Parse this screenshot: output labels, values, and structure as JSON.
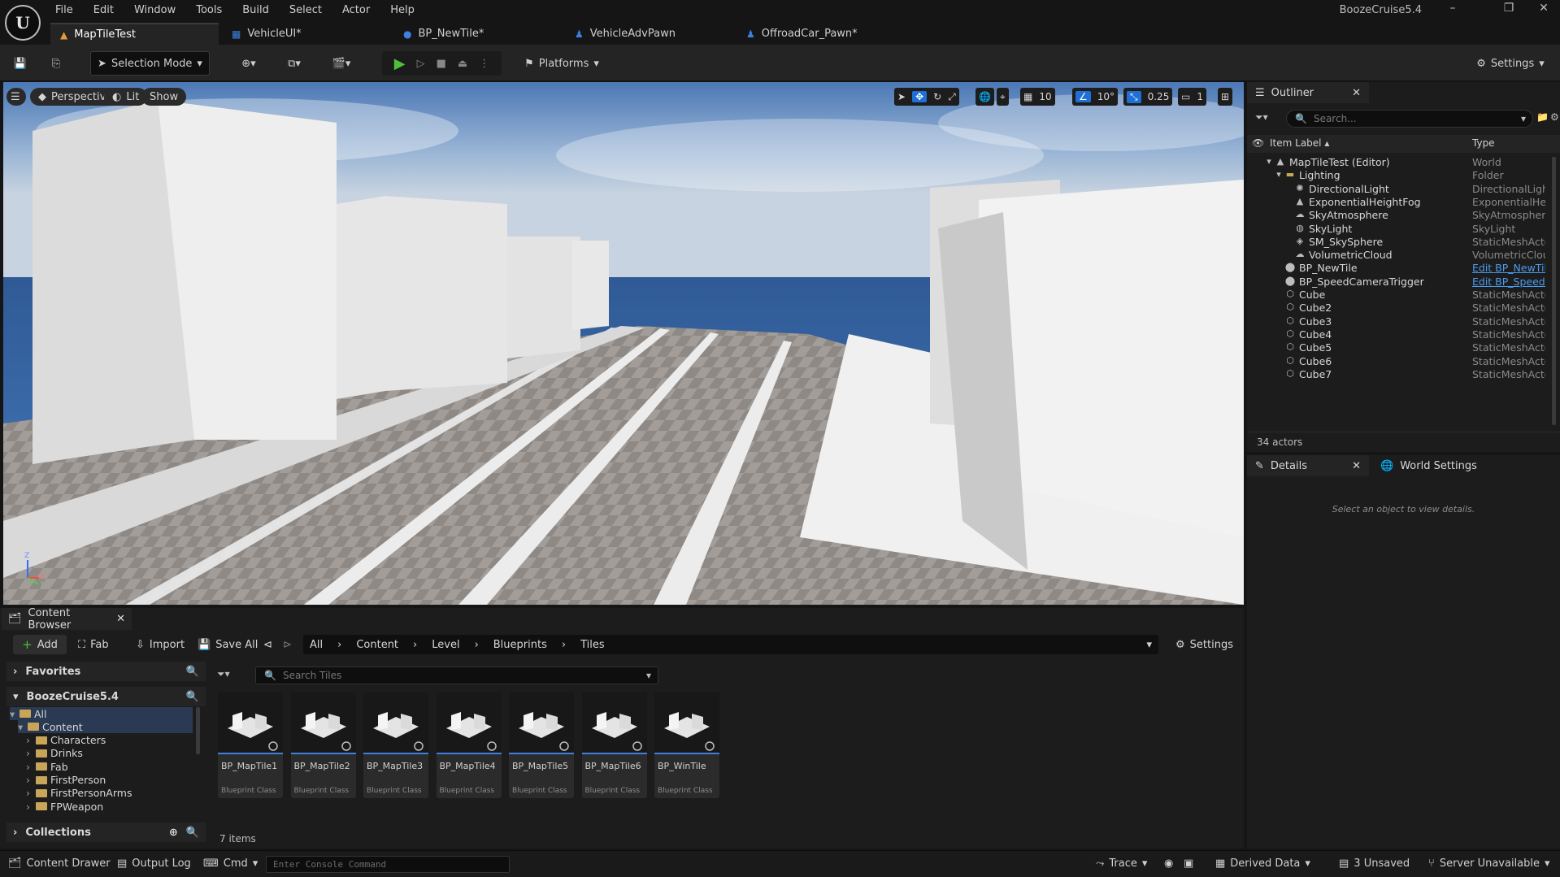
{
  "menu": [
    "File",
    "Edit",
    "Window",
    "Tools",
    "Build",
    "Select",
    "Actor",
    "Help"
  ],
  "project_name": "BoozeCruise5.4",
  "tabs": [
    {
      "label": "MapTileTest",
      "icon": "level-icon"
    },
    {
      "label": "VehicleUI*",
      "icon": "widget-icon"
    },
    {
      "label": "BP_NewTile*",
      "icon": "blueprint-icon"
    },
    {
      "label": "VehicleAdvPawn",
      "icon": "pawn-icon"
    },
    {
      "label": "OffroadCar_Pawn*",
      "icon": "pawn-icon"
    }
  ],
  "toolbar": {
    "selection_mode": "Selection Mode",
    "platforms": "Platforms",
    "settings": "Settings"
  },
  "viewport": {
    "perspective": "Perspective",
    "lit": "Lit",
    "show": "Show",
    "grid_snap": "10",
    "rotation_snap": "10°",
    "scale_snap": "0.25",
    "camera_speed": "1",
    "axis_z": "Z",
    "axis_x": "X",
    "axis_y": "Y"
  },
  "outliner": {
    "title": "Outliner",
    "search_placeholder": "Search...",
    "col_label": "Item Label",
    "col_type": "Type",
    "rows": [
      {
        "label": "MapTileTest (Editor)",
        "type": "World",
        "indent": 0,
        "icon": "world-icon"
      },
      {
        "label": "Lighting",
        "type": "Folder",
        "indent": 1,
        "icon": "folder-icon"
      },
      {
        "label": "DirectionalLight",
        "type": "DirectionalLight",
        "indent": 2,
        "icon": "sun-icon"
      },
      {
        "label": "ExponentialHeightFog",
        "type": "ExponentialHeightFog",
        "indent": 2,
        "icon": "fog-icon"
      },
      {
        "label": "SkyAtmosphere",
        "type": "SkyAtmosphere",
        "indent": 2,
        "icon": "atmosphere-icon"
      },
      {
        "label": "SkyLight",
        "type": "SkyLight",
        "indent": 2,
        "icon": "skylight-icon"
      },
      {
        "label": "SM_SkySphere",
        "type": "StaticMeshActor",
        "indent": 2,
        "icon": "mesh-icon"
      },
      {
        "label": "VolumetricCloud",
        "type": "VolumetricCloud",
        "indent": 2,
        "icon": "cloud-icon"
      },
      {
        "label": "BP_NewTile",
        "type": "Edit BP_NewTile",
        "indent": 1,
        "icon": "actor-icon",
        "link": true
      },
      {
        "label": "BP_SpeedCameraTrigger",
        "type": "Edit BP_SpeedCameraTrigger",
        "indent": 1,
        "icon": "actor-icon",
        "link": true
      },
      {
        "label": "Cube",
        "type": "StaticMeshActor",
        "indent": 1,
        "icon": "cube-icon"
      },
      {
        "label": "Cube2",
        "type": "StaticMeshActor",
        "indent": 1,
        "icon": "cube-icon"
      },
      {
        "label": "Cube3",
        "type": "StaticMeshActor",
        "indent": 1,
        "icon": "cube-icon"
      },
      {
        "label": "Cube4",
        "type": "StaticMeshActor",
        "indent": 1,
        "icon": "cube-icon"
      },
      {
        "label": "Cube5",
        "type": "StaticMeshActor",
        "indent": 1,
        "icon": "cube-icon"
      },
      {
        "label": "Cube6",
        "type": "StaticMeshActor",
        "indent": 1,
        "icon": "cube-icon"
      },
      {
        "label": "Cube7",
        "type": "StaticMeshActor",
        "indent": 1,
        "icon": "cube-icon"
      }
    ],
    "actor_count": "34 actors"
  },
  "details": {
    "title": "Details",
    "world_settings": "World Settings",
    "empty_message": "Select an object to view details."
  },
  "content_browser": {
    "title": "Content Browser",
    "add": "Add",
    "fab": "Fab",
    "import": "Import",
    "save_all": "Save All",
    "breadcrumb": [
      "All",
      "Content",
      "Level",
      "Blueprints",
      "Tiles"
    ],
    "settings": "Settings",
    "favorites": "Favorites",
    "project": "BoozeCruise5.4",
    "tree": [
      {
        "label": "All",
        "indent": 0,
        "open": true
      },
      {
        "label": "Content",
        "indent": 1,
        "open": true
      },
      {
        "label": "Characters",
        "indent": 2
      },
      {
        "label": "Drinks",
        "indent": 2
      },
      {
        "label": "Fab",
        "indent": 2
      },
      {
        "label": "FirstPerson",
        "indent": 2
      },
      {
        "label": "FirstPersonArms",
        "indent": 2
      },
      {
        "label": "FPWeapon",
        "indent": 2
      }
    ],
    "collections": "Collections",
    "search_placeholder": "Search Tiles",
    "assets": [
      {
        "name": "BP_MapTile1",
        "class": "Blueprint Class"
      },
      {
        "name": "BP_MapTile2",
        "class": "Blueprint Class"
      },
      {
        "name": "BP_MapTile3",
        "class": "Blueprint Class"
      },
      {
        "name": "BP_MapTile4",
        "class": "Blueprint Class"
      },
      {
        "name": "BP_MapTile5",
        "class": "Blueprint Class"
      },
      {
        "name": "BP_MapTile6",
        "class": "Blueprint Class"
      },
      {
        "name": "BP_WinTile",
        "class": "Blueprint Class"
      }
    ],
    "item_count": "7 items"
  },
  "statusbar": {
    "content_drawer": "Content Drawer",
    "output_log": "Output Log",
    "cmd": "Cmd",
    "console_placeholder": "Enter Console Command",
    "trace": "Trace",
    "derived_data": "Derived Data",
    "unsaved": "3 Unsaved",
    "source_control": "Server Unavailable"
  }
}
